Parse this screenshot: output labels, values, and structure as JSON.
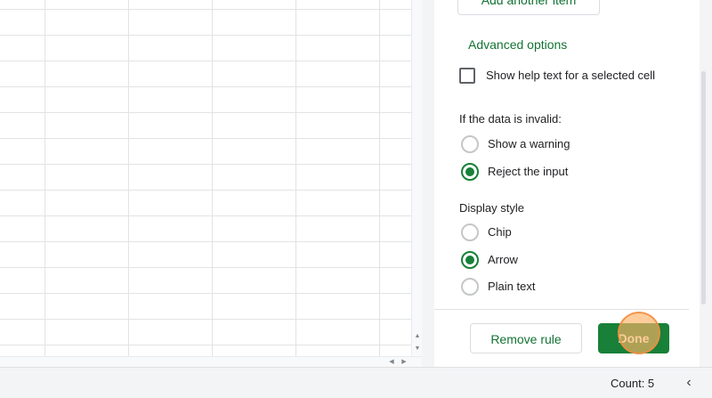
{
  "panel": {
    "add_item_label": "Add another item",
    "advanced_options_label": "Advanced options",
    "help_text_checkbox": {
      "label": "Show help text for a selected cell",
      "checked": false
    },
    "invalid_data": {
      "heading": "If the data is invalid:",
      "options": [
        {
          "label": "Show a warning",
          "checked": false
        },
        {
          "label": "Reject the input",
          "checked": true
        }
      ]
    },
    "display_style": {
      "heading": "Display style",
      "options": [
        {
          "label": "Chip",
          "checked": false
        },
        {
          "label": "Arrow",
          "checked": true
        },
        {
          "label": "Plain text",
          "checked": false
        }
      ]
    },
    "remove_rule_label": "Remove rule",
    "done_label": "Done"
  },
  "statusbar": {
    "count_label": "Count: 5"
  },
  "icons": {
    "scroll_up": "triangle-up",
    "scroll_down": "triangle-down",
    "scroll_left": "triangle-left",
    "scroll_right": "triangle-right",
    "collapse": "chevron-left"
  },
  "colors": {
    "accent_green": "#188038",
    "link_green": "#137333",
    "gridline": "#e2e3e3",
    "panel_bg": "#f3f4f6"
  }
}
